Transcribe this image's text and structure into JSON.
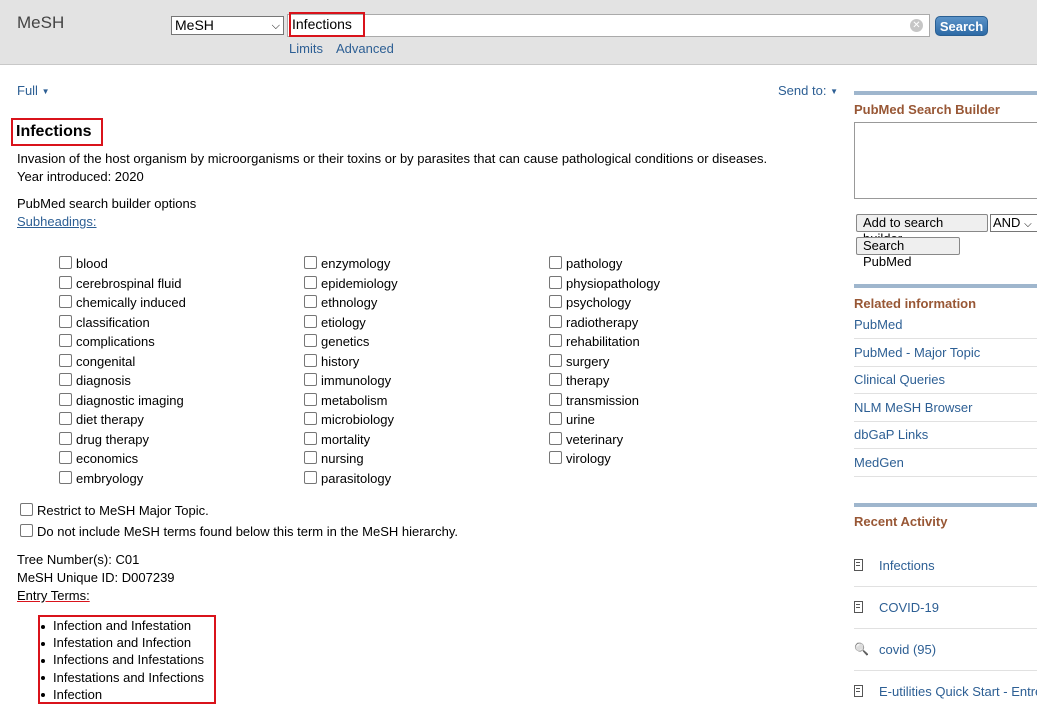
{
  "header": {
    "app_title": "MeSH",
    "database_select": "MeSH",
    "search_value": "Infections",
    "search_button": "Search",
    "links": [
      "Limits",
      "Advanced"
    ]
  },
  "toolbar": {
    "format": "Full",
    "send_to": "Send to:"
  },
  "record": {
    "title": "Infections",
    "scope_note": "Invasion of the host organism by microorganisms or their toxins or by parasites that can cause pathological conditions or diseases.",
    "year_introduced": "Year introduced: 2020",
    "builder_options": "PubMed search builder options",
    "subheadings_link": "Subheadings:",
    "subheadings": [
      [
        "blood",
        "cerebrospinal fluid",
        "chemically induced",
        "classification",
        "complications",
        "congenital",
        "diagnosis",
        "diagnostic imaging",
        "diet therapy",
        "drug therapy",
        "economics",
        "embryology"
      ],
      [
        "enzymology",
        "epidemiology",
        "ethnology",
        "etiology",
        "genetics",
        "history",
        "immunology",
        "metabolism",
        "microbiology",
        "mortality",
        "nursing",
        "parasitology"
      ],
      [
        "pathology",
        "physiopathology",
        "psychology",
        "radiotherapy",
        "rehabilitation",
        "surgery",
        "therapy",
        "transmission",
        "urine",
        "veterinary",
        "virology"
      ]
    ],
    "restrict_major": "Restrict to MeSH Major Topic.",
    "no_explode": "Do not include MeSH terms found below this term in the MeSH hierarchy.",
    "tree_number": "Tree Number(s): C01",
    "unique_id": "MeSH Unique ID: D007239",
    "entry_terms_label": "Entry Terms:",
    "entry_terms": [
      "Infection and Infestation",
      "Infestation and Infection",
      "Infections and Infestations",
      "Infestations and Infections",
      "Infection"
    ]
  },
  "sidebar": {
    "builder_title": "PubMed Search Builder",
    "add_button": "Add to search builder",
    "operator": "AND",
    "search_pubmed_button": "Search PubMed",
    "related_title": "Related information",
    "related_links": [
      "PubMed",
      "PubMed - Major Topic",
      "Clinical Queries",
      "NLM MeSH Browser",
      "dbGaP Links",
      "MedGen"
    ],
    "recent_title": "Recent Activity",
    "recent": [
      {
        "label": "Infections",
        "icon": "document-icon"
      },
      {
        "label": "COVID-19",
        "icon": "document-icon"
      },
      {
        "label": "covid (95)",
        "icon": "search-icon"
      },
      {
        "label": "E-utilities Quick Start - Entrez",
        "icon": "document-icon"
      }
    ]
  }
}
